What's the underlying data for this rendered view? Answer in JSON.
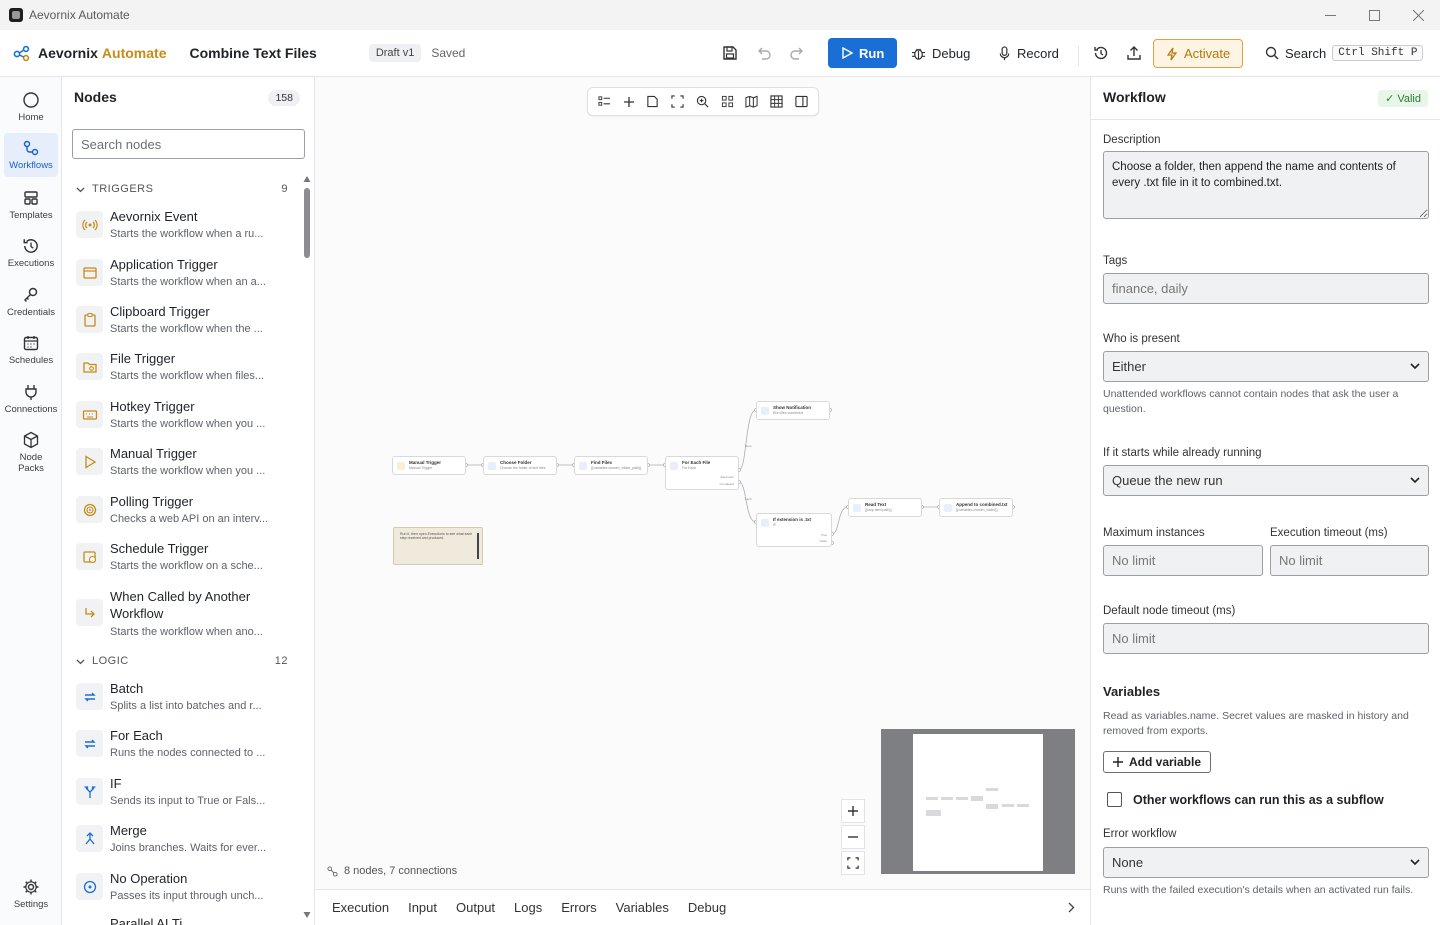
{
  "window": {
    "title": "Aevornix Automate"
  },
  "header": {
    "brand_a": "Aevornix",
    "brand_b": "Automate",
    "workflow_name": "Combine Text Files",
    "draft_badge": "Draft v1",
    "save_state": "Saved",
    "run_label": "Run",
    "debug_label": "Debug",
    "record_label": "Record",
    "activate_label": "Activate",
    "search_label": "Search",
    "search_shortcut": "Ctrl Shift P",
    "accent": "#1a6fd6"
  },
  "rail": [
    {
      "label": "Home",
      "icon": "circle-icon"
    },
    {
      "label": "Workflows",
      "icon": "workflow-icon"
    },
    {
      "label": "Templates",
      "icon": "templates-icon"
    },
    {
      "label": "Executions",
      "icon": "history-icon"
    },
    {
      "label": "Credentials",
      "icon": "key-icon"
    },
    {
      "label": "Schedules",
      "icon": "calendar-icon"
    },
    {
      "label": "Connections",
      "icon": "plug-icon"
    },
    {
      "label": "Node",
      "label2": "Packs",
      "icon": "cube-icon"
    },
    {
      "label": "Settings",
      "icon": "gear-icon"
    }
  ],
  "nodes_panel": {
    "title": "Nodes",
    "count": "158",
    "search_placeholder": "Search nodes",
    "triggers": {
      "label": "TRIGGERS",
      "count": "9",
      "items": [
        {
          "name": "Aevornix Event",
          "desc": "Starts the workflow when a ru..."
        },
        {
          "name": "Application Trigger",
          "desc": "Starts the workflow when an a..."
        },
        {
          "name": "Clipboard Trigger",
          "desc": "Starts the workflow when the ..."
        },
        {
          "name": "File Trigger",
          "desc": "Starts the workflow when files..."
        },
        {
          "name": "Hotkey Trigger",
          "desc": "Starts the workflow when you ..."
        },
        {
          "name": "Manual Trigger",
          "desc": "Starts the workflow when you ..."
        },
        {
          "name": "Polling Trigger",
          "desc": "Checks a web API on an interv..."
        },
        {
          "name": "Schedule Trigger",
          "desc": "Starts the workflow on a sche..."
        },
        {
          "name": "When Called by Another Workflow",
          "desc": "Starts the workflow when ano..."
        }
      ]
    },
    "logic": {
      "label": "LOGIC",
      "count": "12",
      "items": [
        {
          "name": "Batch",
          "desc": "Splits a list into batches and r..."
        },
        {
          "name": "For Each",
          "desc": "Runs the nodes connected to ..."
        },
        {
          "name": "IF",
          "desc": "Sends its input to True or Fals..."
        },
        {
          "name": "Merge",
          "desc": "Joins branches. Waits for ever..."
        },
        {
          "name": "No Operation",
          "desc": "Passes its input through unch..."
        },
        {
          "name": "Parallel AI Ti..."
        }
      ]
    }
  },
  "canvas": {
    "status": "8 nodes, 7 connections",
    "nodes": [
      {
        "title": "Manual Trigger",
        "sub": "Manual Trigger"
      },
      {
        "title": "Choose Folder",
        "sub": "Choose the folder of text files"
      },
      {
        "title": "Find Files",
        "sub": "{{variables.chosen_folder_path}}"
      },
      {
        "title": "For Each File",
        "sub": "For Each"
      },
      {
        "title": "Show Notification",
        "sub": "Run files combined"
      },
      {
        "title": "If extension is .txt",
        "sub": "IF"
      },
      {
        "title": "Read Text",
        "sub": "{{loop.item.path}}"
      },
      {
        "title": "Append to combined.txt",
        "sub": "{{variables.chosen_folder}}"
      }
    ],
    "edge_labels": {
      "done": "done",
      "each": "each",
      "per_item": "Each item",
      "completed": "Completed",
      "true": "True",
      "false": "False"
    },
    "note_text": "Run it, then open Executions to see what each step received and produced."
  },
  "bottom_tabs": [
    "Execution",
    "Input",
    "Output",
    "Logs",
    "Errors",
    "Variables",
    "Debug"
  ],
  "workflow_panel": {
    "title": "Workflow",
    "valid": "Valid",
    "description_label": "Description",
    "description": "Choose a folder, then append the name and contents of every .txt file in it to combined.txt.",
    "tags_label": "Tags",
    "tags_placeholder": "finance, daily",
    "who_label": "Who is present",
    "who_value": "Either",
    "who_help": "Unattended workflows cannot contain nodes that ask the user a question.",
    "running_label": "If it starts while already running",
    "running_value": "Queue the new run",
    "max_label": "Maximum instances",
    "max_placeholder": "No limit",
    "timeout_label": "Execution timeout (ms)",
    "timeout_placeholder": "No limit",
    "node_timeout_label": "Default node timeout (ms)",
    "node_timeout_placeholder": "No limit",
    "variables_label": "Variables",
    "variables_help": "Read as variables.name. Secret values are masked in history and removed from exports.",
    "add_variable": "Add variable",
    "subflow_label": "Other workflows can run this as a subflow",
    "error_label": "Error workflow",
    "error_value": "None",
    "error_help": "Runs with the failed execution's details when an activated run fails."
  }
}
